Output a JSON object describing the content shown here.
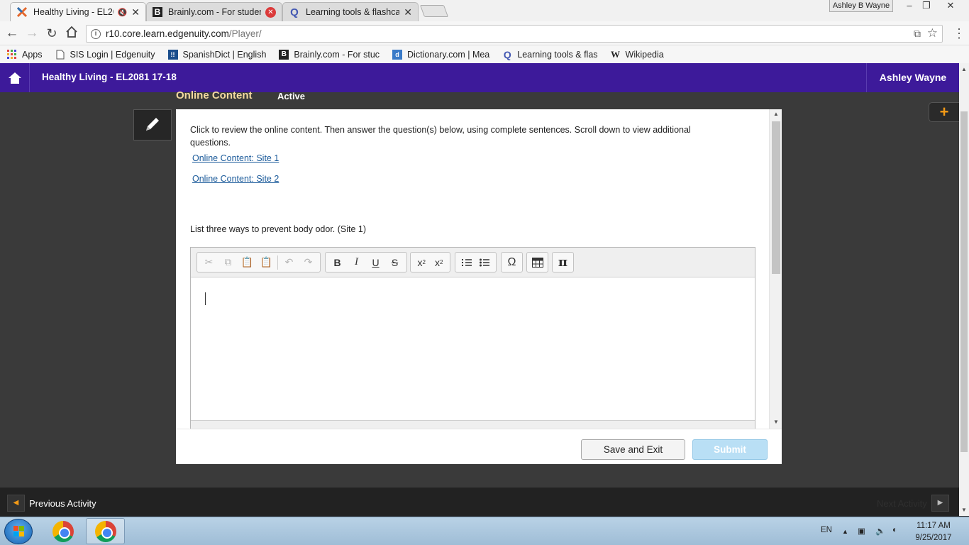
{
  "browser": {
    "tabs": [
      {
        "title": "Healthy Living - EL208",
        "icon": "edgenuity-x-icon"
      },
      {
        "title": "Brainly.com - For student",
        "icon": "brainly-icon"
      },
      {
        "title": "Learning tools & flashcar",
        "icon": "quizlet-icon"
      }
    ],
    "profile_name": "Ashley B Wayne",
    "url_host": "r10.core.learn.edgenuity.com",
    "url_path": "/Player/",
    "bookmarks": [
      {
        "label": "Apps",
        "icon": "apps-grid-icon"
      },
      {
        "label": "SIS Login | Edgenuity",
        "icon": "page-icon"
      },
      {
        "label": "SpanishDict | English",
        "icon": "spanishdict-icon"
      },
      {
        "label": "Brainly.com - For stuc",
        "icon": "brainly-icon"
      },
      {
        "label": "Dictionary.com | Mea",
        "icon": "dictionary-icon"
      },
      {
        "label": "Learning tools & flas",
        "icon": "quizlet-icon"
      },
      {
        "label": "Wikipedia",
        "icon": "wikipedia-icon"
      }
    ]
  },
  "header": {
    "course_title": "Healthy Living - EL2081 17-18",
    "user_name": "Ashley Wayne"
  },
  "activity": {
    "section_title": "Online Content",
    "status": "Active",
    "instructions": "Click to review the online content. Then answer the question(s) below, using complete sentences. Scroll down to view additional questions.",
    "links": [
      "Online Content: Site 1",
      "Online Content: Site 2"
    ],
    "question": "List three ways to prevent body odor. (Site 1)",
    "save_label": "Save and Exit",
    "submit_label": "Submit"
  },
  "editor_toolbar": {
    "bold": "B",
    "italic": "I",
    "underline": "U",
    "strike": "S",
    "special_char": "Ω",
    "math": "π"
  },
  "footer": {
    "prev_label": "Previous Activity",
    "next_label": "Next Activity"
  },
  "taskbar": {
    "language": "EN",
    "time": "11:17 AM",
    "date": "9/25/2017"
  },
  "colors": {
    "app_header": "#3d1a9a",
    "accent_orange": "#f39a16",
    "submit_disabled": "#b9dff5",
    "link": "#1a5a9a"
  }
}
